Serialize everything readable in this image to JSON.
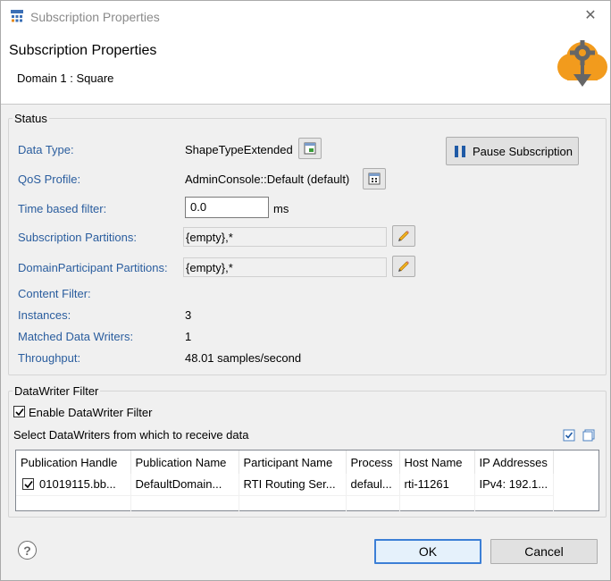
{
  "window": {
    "title": "Subscription Properties",
    "close_glyph": "✕"
  },
  "header": {
    "title": "Subscription Properties",
    "subtitle": "Domain 1 : Square"
  },
  "status": {
    "group_label": "Status",
    "data_type_label": "Data Type:",
    "data_type_value": "ShapeTypeExtended",
    "qos_label": "QoS Profile:",
    "qos_value": "AdminConsole::Default (default)",
    "time_filter_label": "Time based filter:",
    "time_filter_value": "0.0",
    "time_filter_unit": "ms",
    "sub_partitions_label": "Subscription Partitions:",
    "sub_partitions_value": "{empty},*",
    "dp_partitions_label": "DomainParticipant Partitions:",
    "dp_partitions_value": "{empty},*",
    "content_filter_label": "Content Filter:",
    "instances_label": "Instances:",
    "instances_value": "3",
    "matched_label": "Matched Data Writers:",
    "matched_value": "1",
    "throughput_label": "Throughput:",
    "throughput_value": "48.01 samples/second",
    "pause_button": "Pause Subscription"
  },
  "writer_filter": {
    "group_label": "DataWriter Filter",
    "enable_label": "Enable DataWriter Filter",
    "enable_checked": true,
    "select_label": "Select DataWriters from which to receive data",
    "columns": [
      "Publication Handle",
      "Publication Name",
      "Participant Name",
      "Process",
      "Host Name",
      "IP Addresses"
    ],
    "rows": [
      {
        "checked": true,
        "cells": [
          "01019115.bb...",
          "DefaultDomain...",
          "RTI Routing Ser...",
          "defaul...",
          "rti-11261",
          "IPv4: 192.1..."
        ]
      }
    ]
  },
  "footer": {
    "help_glyph": "?",
    "ok_label": "OK",
    "cancel_label": "Cancel"
  },
  "colors": {
    "label_blue": "#2a5d9e",
    "banner_orange": "#f29b1d",
    "accent": "#3c7fd6"
  }
}
